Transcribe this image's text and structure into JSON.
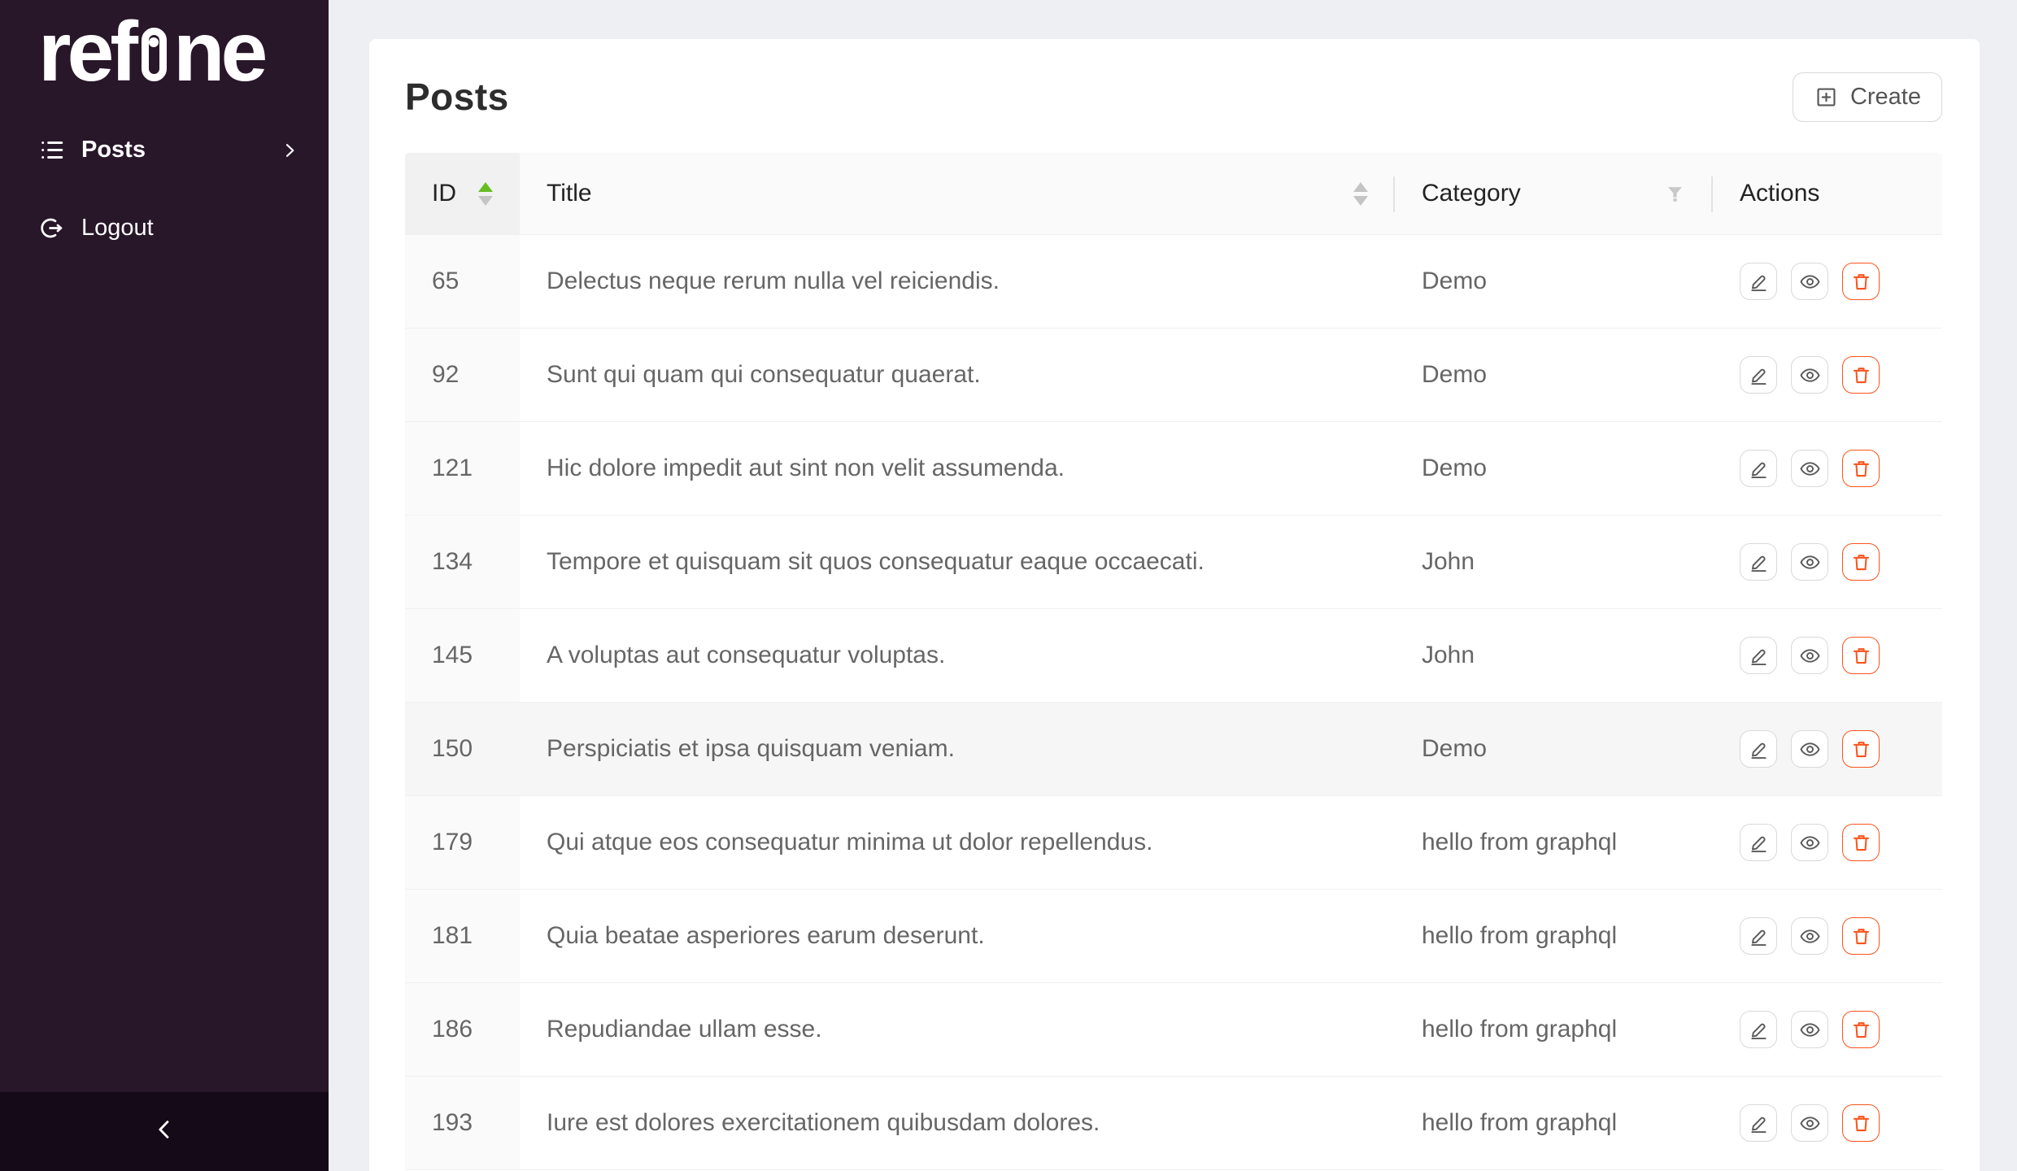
{
  "brand": {
    "logo_left": "ref",
    "logo_right": "ne"
  },
  "sidebar": {
    "posts_item": {
      "label": "Posts",
      "icon": "unordered-list-icon",
      "expand_icon": "chevron-right-icon",
      "active": true
    },
    "logout_item": {
      "label": "Logout",
      "icon": "logout-icon"
    },
    "collapse_icon": "chevron-left-icon"
  },
  "page": {
    "title": "Posts",
    "create_button": {
      "label": "Create",
      "icon": "plus-square-icon"
    }
  },
  "table": {
    "columns": [
      {
        "key": "id",
        "label": "ID",
        "sorter": true,
        "sort_active": "asc"
      },
      {
        "key": "title",
        "label": "Title",
        "sorter": true,
        "sort_active": null
      },
      {
        "key": "category",
        "label": "Category",
        "filter": true
      },
      {
        "key": "actions",
        "label": "Actions"
      }
    ],
    "row_actions": [
      "edit",
      "show",
      "delete"
    ],
    "rows": [
      {
        "id": "65",
        "title": "Delectus neque rerum nulla vel reiciendis.",
        "category": "Demo",
        "highlighted": false
      },
      {
        "id": "92",
        "title": "Sunt qui quam qui consequatur quaerat.",
        "category": "Demo",
        "highlighted": false
      },
      {
        "id": "121",
        "title": "Hic dolore impedit aut sint non velit assumenda.",
        "category": "Demo",
        "highlighted": false
      },
      {
        "id": "134",
        "title": "Tempore et quisquam sit quos consequatur eaque occaecati.",
        "category": "John",
        "highlighted": false
      },
      {
        "id": "145",
        "title": "A voluptas aut consequatur voluptas.",
        "category": "John",
        "highlighted": false
      },
      {
        "id": "150",
        "title": "Perspiciatis et ipsa quisquam veniam.",
        "category": "Demo",
        "highlighted": true
      },
      {
        "id": "179",
        "title": "Qui atque eos consequatur minima ut dolor repellendus.",
        "category": "hello from graphql",
        "highlighted": false
      },
      {
        "id": "181",
        "title": "Quia beatae asperiores earum deserunt.",
        "category": "hello from graphql",
        "highlighted": false
      },
      {
        "id": "186",
        "title": "Repudiandae ullam esse.",
        "category": "hello from graphql",
        "highlighted": false
      },
      {
        "id": "193",
        "title": "Iure est dolores exercitationem quibusdam dolores.",
        "category": "hello from graphql",
        "highlighted": false
      }
    ]
  },
  "colors": {
    "sidebar_bg": "#281629",
    "sidebar_trigger_bg": "#150a17",
    "page_bg": "#edeff2",
    "accent_green": "#67be23",
    "danger_orange": "#fa541c",
    "border_gray": "#d9d9d9"
  }
}
